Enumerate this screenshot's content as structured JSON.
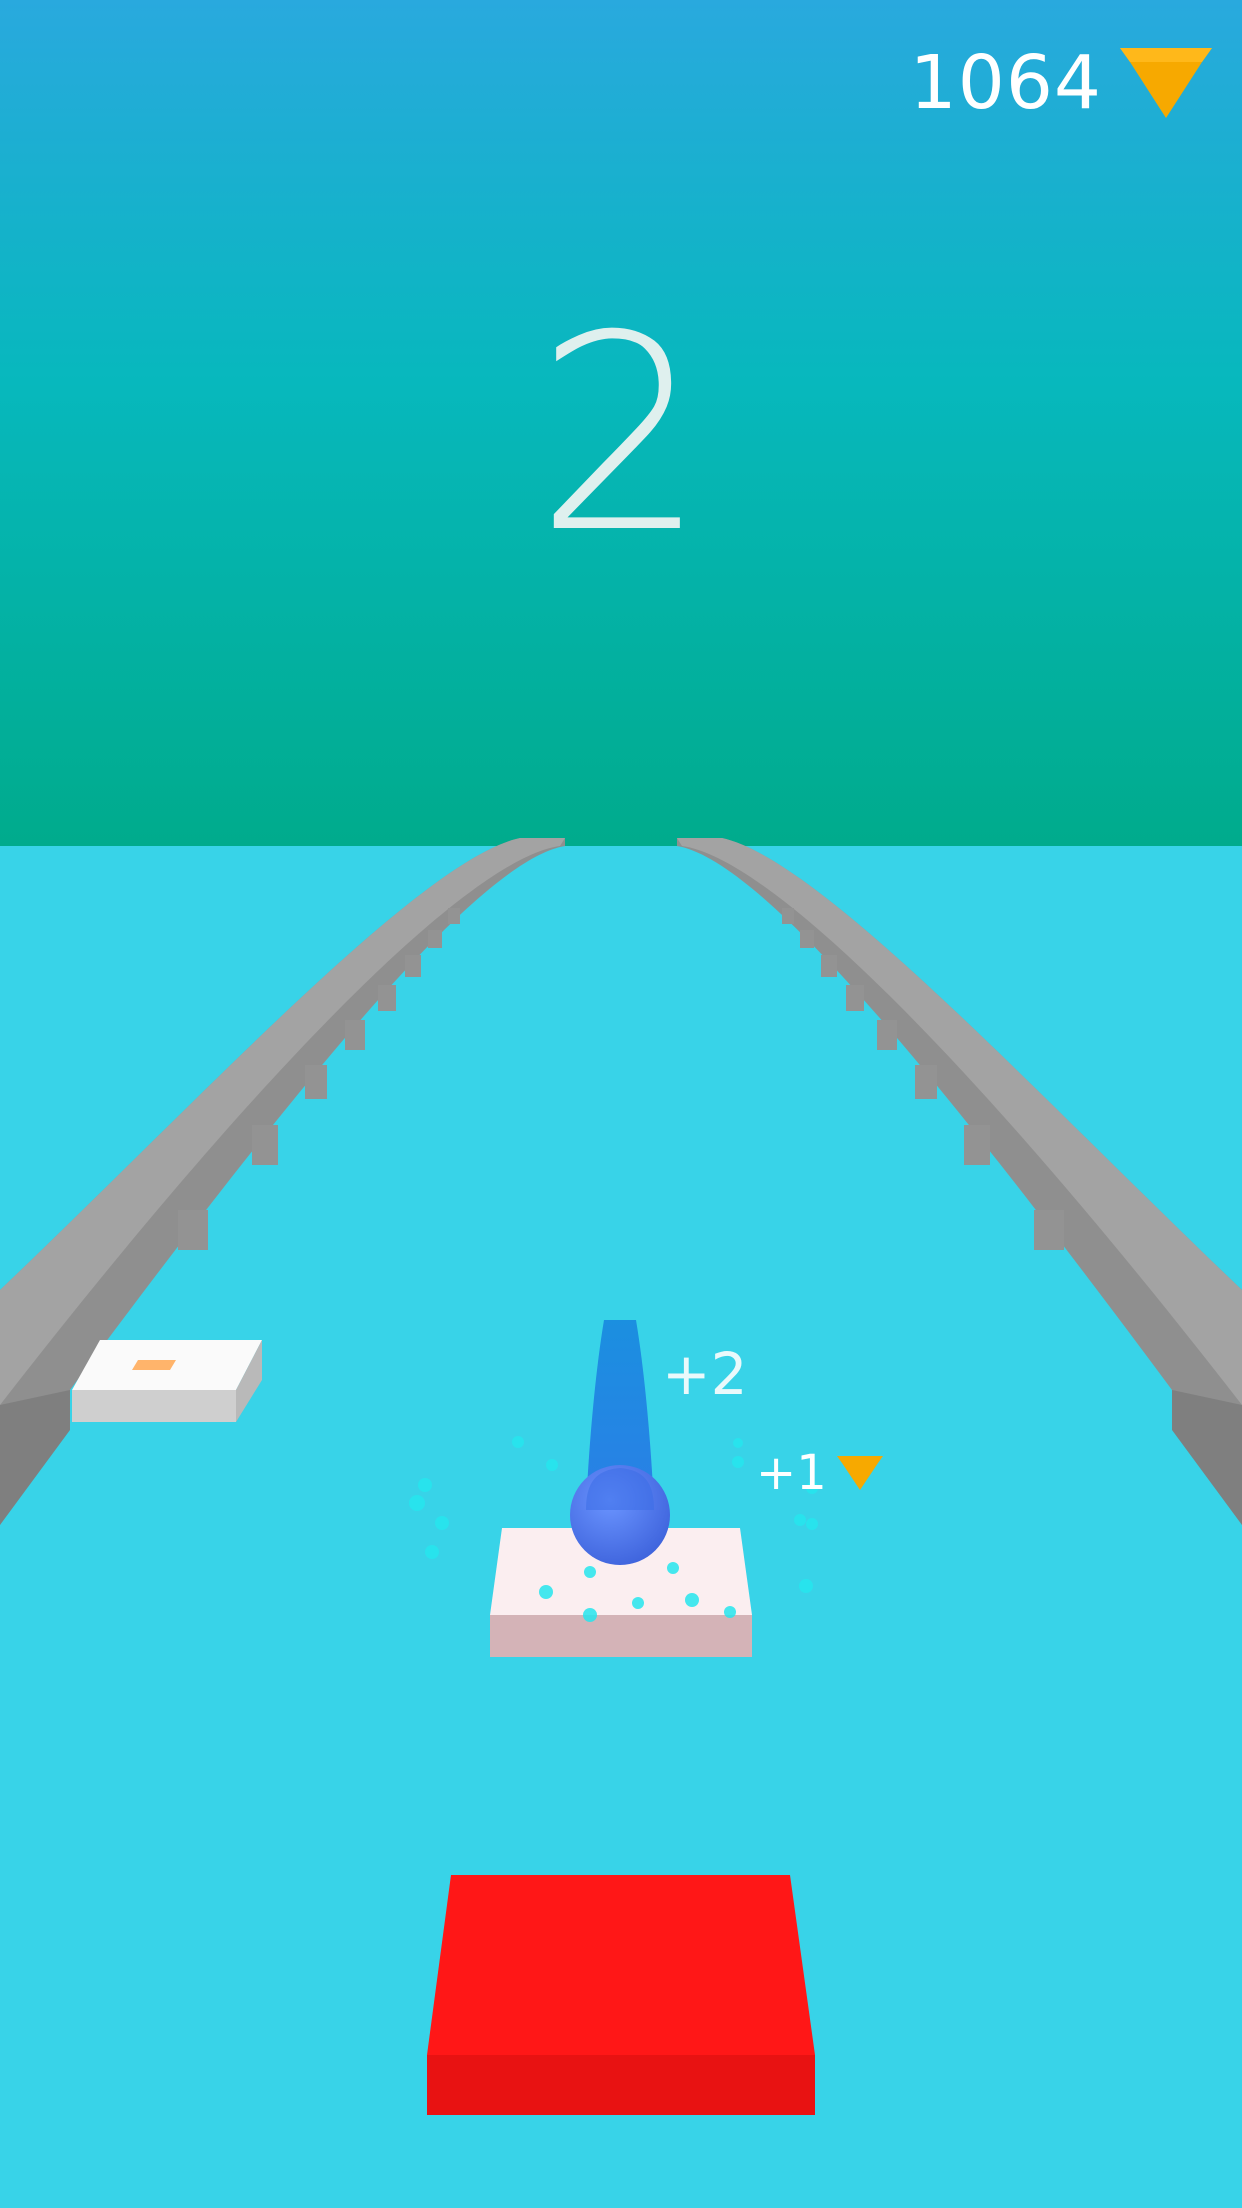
{
  "hud": {
    "gem_count": "1064",
    "gem_icon": "diamond-icon",
    "gem_color": "#f7a900"
  },
  "score": "2",
  "popups": {
    "score_bonus": "+2",
    "gem_bonus": "+1"
  },
  "colors": {
    "sky_top": "#29a9de",
    "sky_bottom": "#00ab8c",
    "floor": "#38d3e8",
    "rail": "#9a9a9a",
    "ball": "#4f7ff0",
    "active_tile": "#fbeef0",
    "hazard_tile": "#ff1717"
  }
}
